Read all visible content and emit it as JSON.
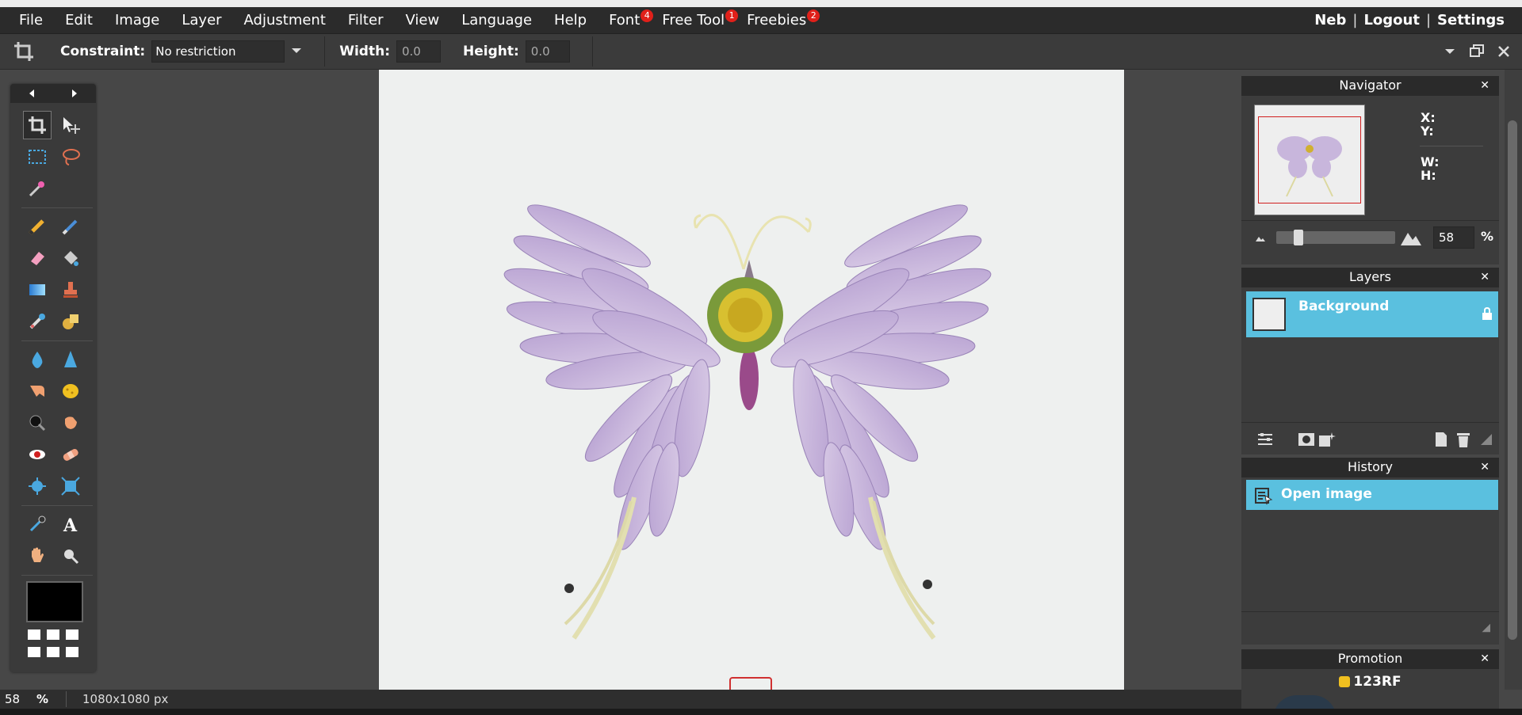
{
  "menubar": {
    "menus": [
      {
        "label": "File"
      },
      {
        "label": "Edit"
      },
      {
        "label": "Image"
      },
      {
        "label": "Layer"
      },
      {
        "label": "Adjustment"
      },
      {
        "label": "Filter"
      },
      {
        "label": "View"
      },
      {
        "label": "Language"
      },
      {
        "label": "Help"
      },
      {
        "label": "Font",
        "badge": "4"
      },
      {
        "label": "Free Tool",
        "badge": "1"
      },
      {
        "label": "Freebies",
        "badge": "2"
      }
    ],
    "user": "Neb",
    "logout": "Logout",
    "settings": "Settings",
    "separator": "|"
  },
  "options": {
    "constraint_label": "Constraint:",
    "constraint_value": "No restriction",
    "width_label": "Width:",
    "width_value": "0.0",
    "height_label": "Height:",
    "height_value": "0.0"
  },
  "navigator": {
    "title": "Navigator",
    "x_label": "X:",
    "y_label": "Y:",
    "w_label": "W:",
    "h_label": "H:",
    "zoom": "58",
    "zoom_unit": "%"
  },
  "layers": {
    "title": "Layers",
    "items": [
      {
        "name": "Background",
        "locked": true
      }
    ]
  },
  "history": {
    "title": "History",
    "items": [
      {
        "label": "Open image"
      }
    ]
  },
  "promotion": {
    "title": "Promotion",
    "brand": "123RF"
  },
  "status": {
    "zoom": "58",
    "zoom_unit": "%",
    "dimensions": "1080x1080 px"
  },
  "colors": {
    "accent": "#5ac0df",
    "badge": "#e0201a",
    "foreground_color": "#000000"
  }
}
